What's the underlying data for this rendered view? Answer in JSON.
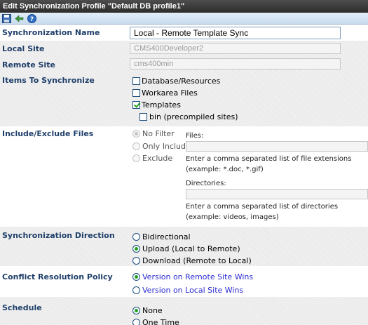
{
  "window": {
    "title": "Edit Synchronization Profile \"Default DB profile1\""
  },
  "toolbar": {
    "save_icon": "save-icon",
    "back_icon": "back-arrow-icon",
    "help_icon": "help-icon"
  },
  "form": {
    "sync_name": {
      "label": "Synchronization Name",
      "value": "Local - Remote Template Sync"
    },
    "local_site": {
      "label": "Local Site",
      "value": "CMS400Developer2"
    },
    "remote_site": {
      "label": "Remote Site",
      "value": "cms400min"
    },
    "items": {
      "label": "Items To Synchronize",
      "options": [
        {
          "label": "Database/Resources",
          "checked": false
        },
        {
          "label": "Workarea Files",
          "checked": false
        },
        {
          "label": "Templates",
          "checked": true
        },
        {
          "label": "bin (precompiled sites)",
          "checked": false
        }
      ]
    },
    "include_exclude": {
      "label": "Include/Exclude Files",
      "options": [
        "No Filter",
        "Only Include",
        "Exclude"
      ],
      "selected": "No Filter",
      "files_label": "Files:",
      "files_hint_1": "Enter a comma separated list of file extensions",
      "files_hint_2": "(example: *.doc, *.gif)",
      "dirs_label": "Directories:",
      "dirs_hint_1": "Enter a comma separated list of directories",
      "dirs_hint_2": "(example: videos, images)"
    },
    "direction": {
      "label": "Synchronization Direction",
      "options": [
        "Bidirectional",
        "Upload (Local to Remote)",
        "Download (Remote to Local)"
      ],
      "selected": "Upload (Local to Remote)"
    },
    "conflict": {
      "label": "Conflict Resolution Policy",
      "options": [
        "Version on Remote Site Wins",
        "Version on Local Site Wins"
      ],
      "selected": "Version on Remote Site Wins"
    },
    "schedule": {
      "label": "Schedule",
      "options": [
        "None",
        "One Time"
      ],
      "selected": "None"
    }
  },
  "colors": {
    "label": "#1f3f6a",
    "check": "#21a121",
    "link": "#2b2bd2",
    "header": "#3a3a3a"
  }
}
